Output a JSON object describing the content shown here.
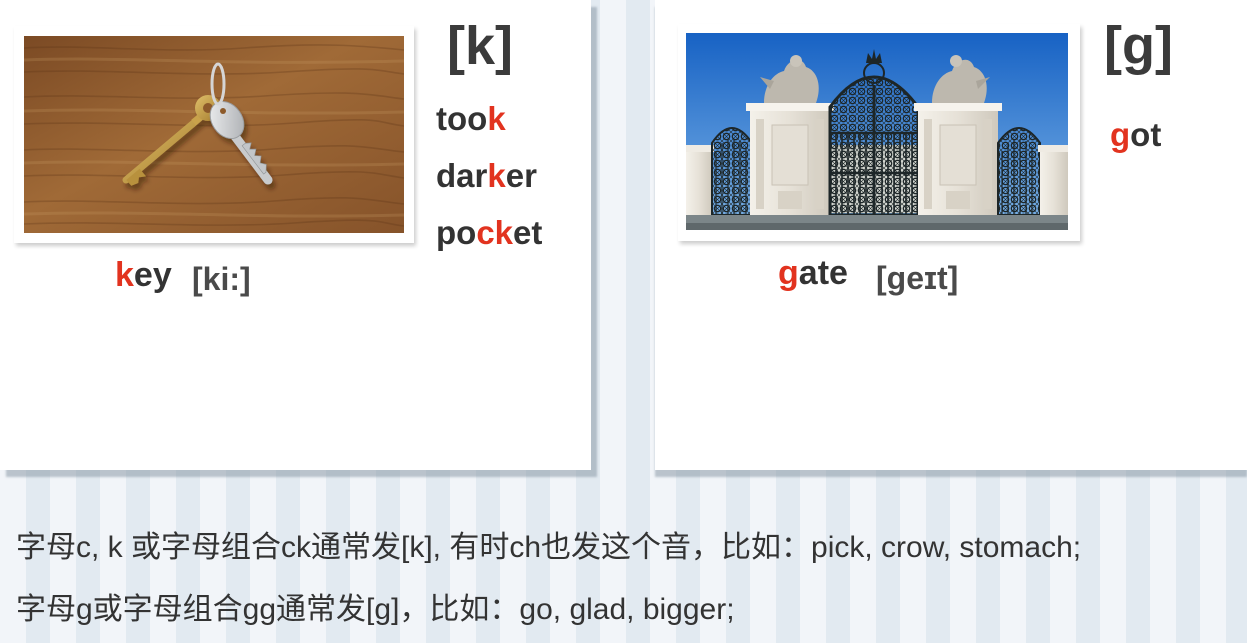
{
  "colors": {
    "highlight": "#e2331f",
    "text": "#333333",
    "phonetic": "#4a4a4a"
  },
  "left_card": {
    "symbol": "[k]",
    "examples": [
      [
        {
          "text": "too"
        },
        {
          "text": "k",
          "highlight": true
        }
      ],
      [
        {
          "text": "dar"
        },
        {
          "text": "k",
          "highlight": true
        },
        {
          "text": "er"
        }
      ],
      [
        {
          "text": "po"
        },
        {
          "text": "ck",
          "highlight": true
        },
        {
          "text": "et"
        }
      ]
    ],
    "keyword": [
      {
        "text": "k",
        "highlight": true
      },
      {
        "text": "ey"
      }
    ],
    "phonetic": "[ki:]"
  },
  "right_card": {
    "symbol": "[g]",
    "examples": [
      [
        {
          "text": "g",
          "highlight": true
        },
        {
          "text": "ot"
        }
      ]
    ],
    "keyword": [
      {
        "text": "g",
        "highlight": true
      },
      {
        "text": "ate"
      }
    ],
    "phonetic": "[geɪt]"
  },
  "notes": [
    "字母c, k 或字母组合ck通常发[k], 有时ch也发这个音，比如：pick, crow, stomach;",
    "字母g或字母组合gg通常发[g]，比如：go, glad, bigger;"
  ]
}
